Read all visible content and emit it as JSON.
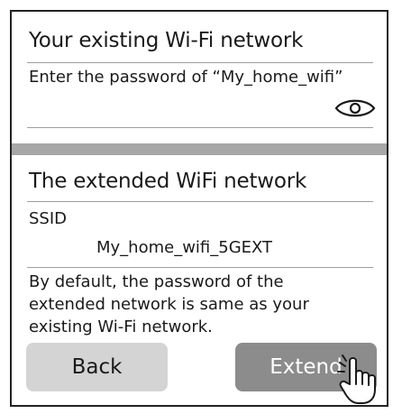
{
  "existing": {
    "title": "Your existing Wi-Fi network",
    "prompt": "Enter the password of “My_home_wifi”",
    "password_value": ""
  },
  "extended": {
    "title": "The extended WiFi network",
    "ssid_label": "SSID",
    "ssid_value": "My_home_wifi_5GEXT",
    "description_line1": "By default, the password of the",
    "description_line2": "extended network is same as your",
    "description_line3": "existing Wi-Fi network."
  },
  "buttons": {
    "back_label": "Back",
    "extend_label": "Extend"
  },
  "icons": {
    "show_password": "eye-icon",
    "cursor": "hand-pointer-icon"
  },
  "colors": {
    "band": "#a7a7a7",
    "back_button": "#d4d4d4",
    "extend_button": "#8c8c8c"
  }
}
